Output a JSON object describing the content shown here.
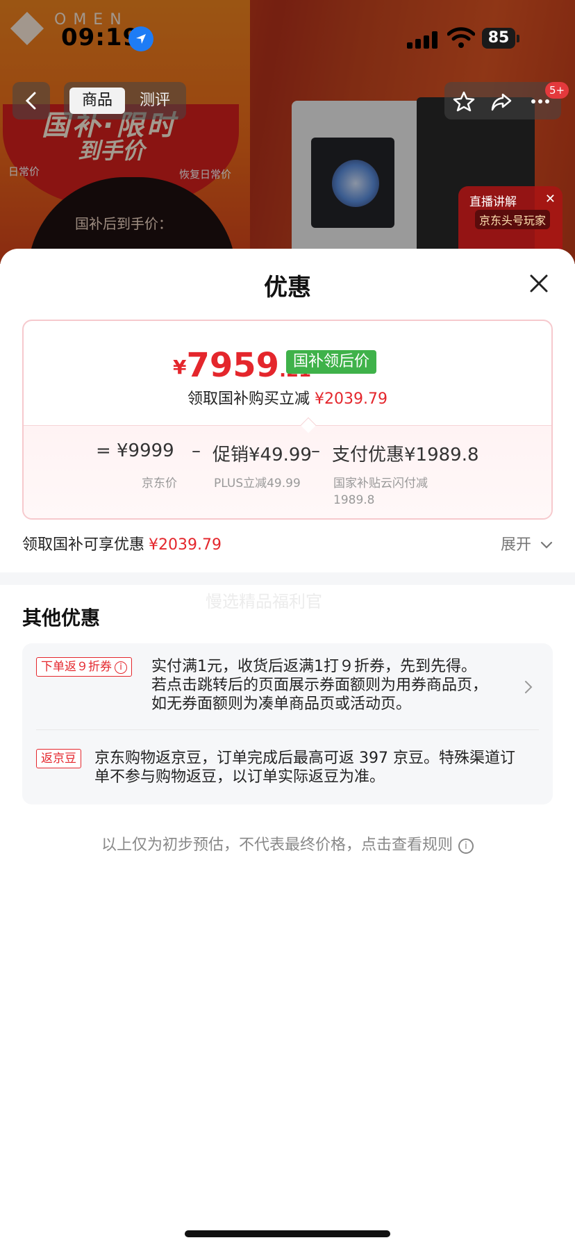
{
  "status_bar": {
    "time": "09:19",
    "battery": "85"
  },
  "product_bg": {
    "brand": "OMEN",
    "promo_title": "国补·限时",
    "promo_sub": "到手价",
    "side_left": "日常价",
    "side_right": "恢复日常价",
    "after_subsidy": "国补后到手价："
  },
  "nav": {
    "tabs": [
      "商品",
      "测评"
    ],
    "cart_badge": "5+"
  },
  "live": {
    "title": "直播讲解",
    "channel": "京东头号玩家"
  },
  "sheet": {
    "title": "优惠",
    "final_price": {
      "currency": "¥",
      "integer": "7959",
      "decimal": ".21"
    },
    "subsidy_tag": "国补领后价",
    "reduce_label": "领取国补购买立减",
    "reduce_amount": "¥2039.79",
    "formula": {
      "equals": "=",
      "jd_price": "¥9999",
      "minus1": "–",
      "promo": "促销¥49.99",
      "minus2": "–",
      "pay_discount": "支付优惠¥1989.8"
    },
    "captions": {
      "jd_price": "京东价",
      "promo": "PLUS立减49.99",
      "pay_line1": "国家补贴云闪付减",
      "pay_line2": "1989.8"
    },
    "benefit_label": "领取国补可享优惠",
    "benefit_amount": "¥2039.79",
    "expand_label": "展开",
    "watermark": "慢选精品福利官",
    "other_title": "其他优惠",
    "offers": [
      {
        "tag": "下单返９折券",
        "lines": [
          "实付满1元，收货后返满1打９折券，先到先得。",
          "若点击跳转后的页面展示券面额则为用券商品页，",
          "如无券面额则为凑单商品页或活动页。"
        ]
      },
      {
        "tag": "返京豆",
        "lines": [
          "京东购物返京豆，订单完成后最高可返 397 京豆。特殊渠道订",
          "单不参与购物返豆，以订单实际返豆为准。"
        ]
      }
    ],
    "disclaimer": "以上仅为初步预估，不代表最终价格，点击查看规则"
  },
  "colors": {
    "accent_red": "#e4262c",
    "tag_green": "#3fb24a"
  }
}
